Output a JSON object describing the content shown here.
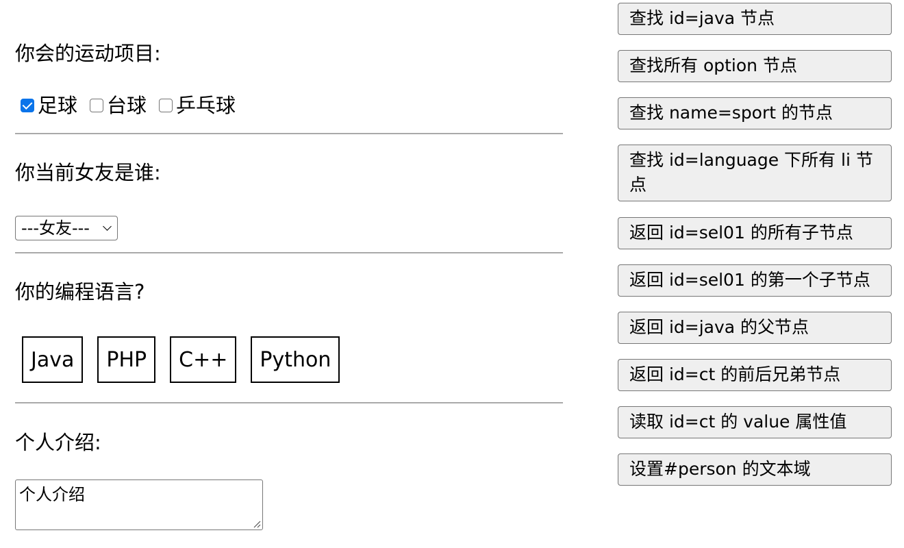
{
  "sports": {
    "title": "你会的运动项目:",
    "options": [
      {
        "label": "足球",
        "checked": true
      },
      {
        "label": "台球",
        "checked": false
      },
      {
        "label": "乒乓球",
        "checked": false
      }
    ]
  },
  "girlfriend": {
    "title": "你当前女友是谁:",
    "select_value": "---女友---"
  },
  "language": {
    "title": "你的编程语言?",
    "items": [
      "Java",
      "PHP",
      "C++",
      "Python"
    ]
  },
  "intro": {
    "title": "个人介绍:",
    "textarea_value": "个人介绍"
  },
  "buttons": [
    "查找 id=java 节点",
    "查找所有 option 节点",
    "查找 name=sport 的节点",
    "查找 id=language 下所有 li 节点",
    "返回 id=sel01 的所有子节点",
    "返回 id=sel01 的第一个子节点",
    "返回 id=java 的父节点",
    "返回 id=ct 的前后兄弟节点",
    "读取 id=ct 的 value 属性值",
    "设置#person 的文本域"
  ],
  "colors": {
    "checkbox_checked": "#0a74ea",
    "button_bg": "#efefef",
    "divider": "#a9a9a9"
  }
}
